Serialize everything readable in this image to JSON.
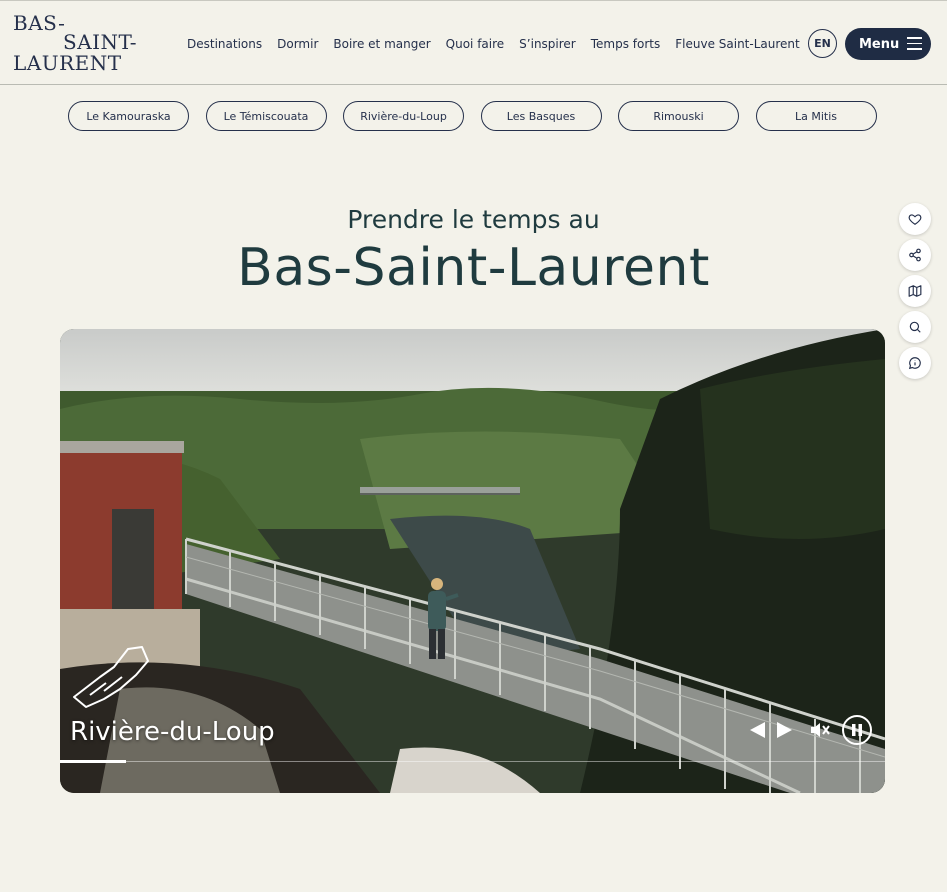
{
  "logo": {
    "line1": "BAS-",
    "line2": "SAINT-",
    "line3": "LAURENT"
  },
  "nav": {
    "items": [
      {
        "label": "Destinations"
      },
      {
        "label": "Dormir"
      },
      {
        "label": "Boire et manger"
      },
      {
        "label": "Quoi faire"
      },
      {
        "label": "S’inspirer"
      },
      {
        "label": "Temps forts"
      },
      {
        "label": "Fleuve Saint-Laurent"
      }
    ],
    "lang_label": "EN",
    "menu_label": "Menu"
  },
  "regions": [
    {
      "label": "Le Kamouraska"
    },
    {
      "label": "Le Témiscouata"
    },
    {
      "label": "Rivière-du-Loup"
    },
    {
      "label": "Les Basques"
    },
    {
      "label": "Rimouski"
    },
    {
      "label": "La Mitis"
    }
  ],
  "hero": {
    "pretitle": "Prendre le temps au",
    "title": "Bas-Saint-Laurent"
  },
  "side_tools": [
    {
      "icon": "heart-icon"
    },
    {
      "icon": "share-icon"
    },
    {
      "icon": "map-icon"
    },
    {
      "icon": "search-icon"
    },
    {
      "icon": "info-chat-icon"
    }
  ],
  "video": {
    "caption": "Rivière-du-Loup",
    "progress": 0.08,
    "muted": true,
    "playing": true
  },
  "colors": {
    "background": "#f3f2ea",
    "navy": "#1f2c44",
    "teal_text": "#1f3b3f"
  }
}
